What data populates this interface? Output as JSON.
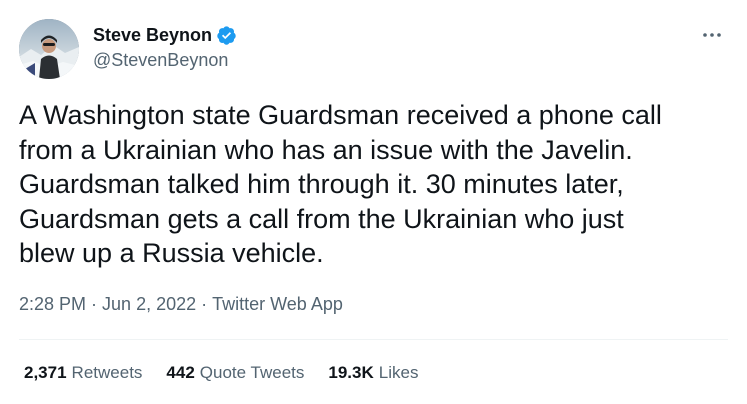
{
  "author": {
    "display_name": "Steve Beynon",
    "handle": "@StevenBeynon",
    "verified": true,
    "avatar_icon": "avatar-photo"
  },
  "tweet": {
    "text": "A Washington state Guardsman received a phone call\nfrom a Ukrainian who has an issue with the Javelin.\nGuardsman talked him through it. 30 minutes later,\nGuardsman gets a call from the Ukrainian who just\nblew up a Russia vehicle.",
    "time": "2:28 PM",
    "date": "Jun 2, 2022",
    "source": "Twitter Web App",
    "separator": "·"
  },
  "stats": {
    "retweets_count": "2,371",
    "retweets_label": "Retweets",
    "quotes_count": "442",
    "quotes_label": "Quote Tweets",
    "likes_count": "19.3K",
    "likes_label": "Likes"
  },
  "colors": {
    "text_primary": "#0f1419",
    "text_secondary": "#536471",
    "verified_blue": "#1d9bf0",
    "divider": "#eff3f4"
  },
  "icons": {
    "verified": "verified-badge-icon",
    "more": "more-horizontal-icon"
  }
}
